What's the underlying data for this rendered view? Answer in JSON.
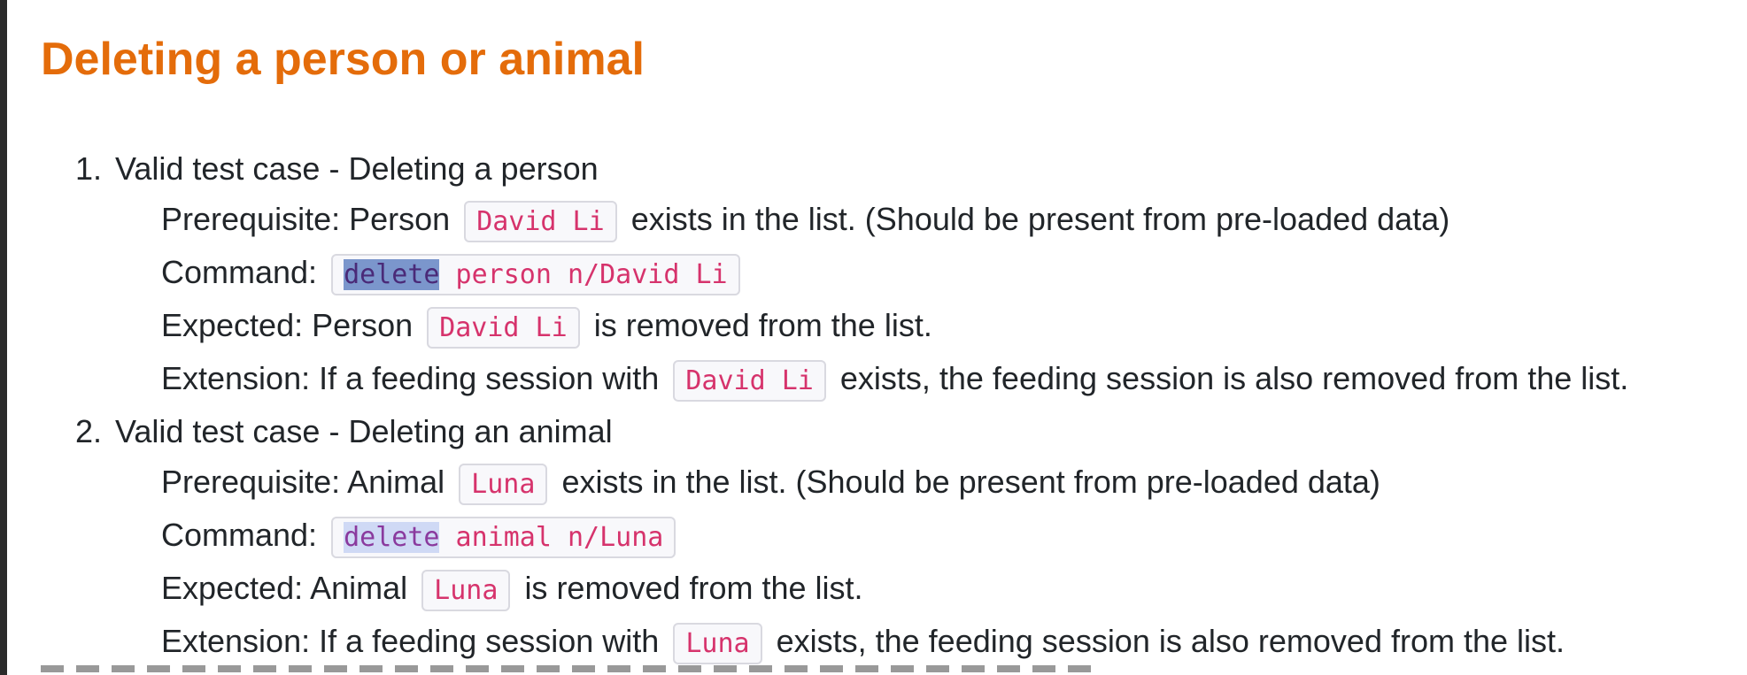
{
  "heading": "Deleting a person or animal",
  "cases": [
    {
      "number": "1.",
      "title": "Valid test case - Deleting a person",
      "prereq_pre": "Prerequisite: Person",
      "prereq_code": "David Li",
      "prereq_post": "exists in the list. (Should be present from pre-loaded data)",
      "command_label": "Command:",
      "command_keyword": "delete",
      "command_rest": " person n/David Li",
      "expected_pre": "Expected: Person",
      "expected_code": "David Li",
      "expected_post": "is removed from the list.",
      "extension_pre": "Extension: If a feeding session with",
      "extension_code": "David Li",
      "extension_post": "exists, the feeding session is also removed from the list."
    },
    {
      "number": "2.",
      "title": "Valid test case - Deleting an animal",
      "prereq_pre": "Prerequisite: Animal",
      "prereq_code": "Luna",
      "prereq_post": "exists in the list. (Should be present from pre-loaded data)",
      "command_label": "Command:",
      "command_keyword": "delete",
      "command_rest": " animal n/Luna",
      "expected_pre": "Expected: Animal",
      "expected_code": "Luna",
      "expected_post": "is removed from the list.",
      "extension_pre": "Extension: If a feeding session with",
      "extension_code": "Luna",
      "extension_post": "exists, the feeding session is also removed from the list."
    }
  ]
}
